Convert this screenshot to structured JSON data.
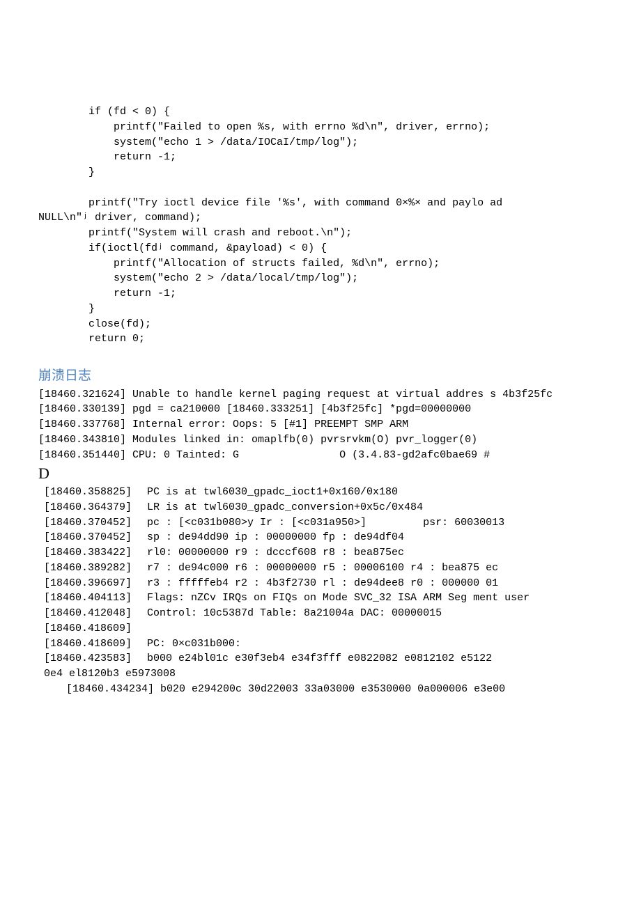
{
  "codeBlock": "        if (fd < 0) {\n            printf(\"Failed to open %s, with errno %d\\n\", driver, errno);\n            system(\"echo 1 > /data/IOCaI/tmp/log\");\n            return -1;\n        }\n\n        printf(\"Try ioctl device file '%s', with command 0×%× and paylo ad\nNULL\\n\"ʲ driver, command);\n        printf(\"System will crash and reboot.\\n\");\n        if(ioctl(fdʲ command, &payload) < 0) {\n            printf(\"Allocation of structs failed, %d\\n\", errno);\n            system(\"echo 2 > /data/local/tmp/log\");\n            return -1;\n        }\n        close(fd);\n        return 0;",
  "sectionHeading": "崩溃日志",
  "logHead": "[18460.321624] Unable to handle kernel paging request at virtual addres s 4b3f25fc [18460.330139] pgd = ca210000 [18460.333251] [4b3f25fc] *pgd=00000000\n[18460.337768] Internal error: Oops: 5 [#1] PREEMPT SMP ARM\n[18460.343810] Modules linked in: omaplfb(0) pvrsrvkm(O) pvr_logger(0)\n[18460.351440] CPU: 0 Tainted: G                O (3.4.83-gd2afc0bae69 #",
  "bigD": "D",
  "logBody": [
    {
      "ts": "[18460.358825]",
      "msg": "PC is at twl6030_gpadc_ioct1+0x160/0x180"
    },
    {
      "ts": "[18460.364379]",
      "msg": "LR is at twl6030_gpadc_conversion+0x5c/0x484"
    },
    {
      "ts": "[18460.370452]",
      "msg": "pc : [<c031b080>y Ir : [<c031a950>]         psr: 60030013"
    },
    {
      "ts": "[18460.370452]",
      "msg": "sp : de94dd90 ip : 00000000 fp : de94df04"
    },
    {
      "ts": "[18460.383422]",
      "msg": "rl0: 00000000 r9 : dcccf608 r8 : bea875ec"
    },
    {
      "ts": "[18460.389282]",
      "msg": "r7 : de94c000 r6 : 00000000 r5 : 00006100 r4 : bea875 ec"
    },
    {
      "ts": "[18460.396697]",
      "msg": "r3 : fffffeb4 r2 : 4b3f2730 rl : de94dee8 r0 : 000000 01"
    },
    {
      "ts": "[18460.404113]",
      "msg": "Flags: nZCv IRQs on FIQs on Mode SVC_32 ISA ARM Seg ment user"
    },
    {
      "ts": "[18460.412048]",
      "msg": "Control: 10c5387d Table: 8a21004a DAC: 00000015"
    },
    {
      "ts": "[18460.418609]",
      "msg": ""
    },
    {
      "ts": "[18460.418609]",
      "msg": "PC: 0×c031b000:"
    },
    {
      "ts": "[18460.423583]",
      "msg": "b000 e24bl01c e30f3eb4 e34f3fff e0822082 e0812102 e5122"
    }
  ],
  "logTail": "0e4 el8120b3 e5973008",
  "logIndent": "[18460.434234] b020 e294200c 30d22003 33a03000 e3530000 0a000006 e3e00"
}
